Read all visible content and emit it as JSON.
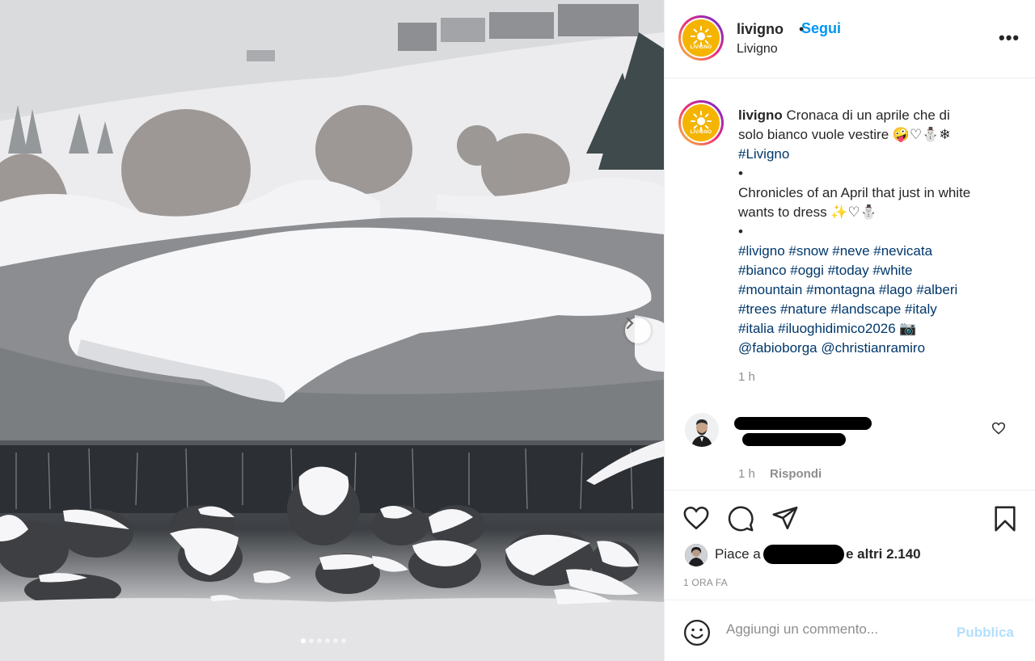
{
  "post": {
    "username": "livigno",
    "follow_separator": "•",
    "follow_label": "Segui",
    "location": "Livigno",
    "more_label": "•••",
    "avatar_brand": "LIVIGNO"
  },
  "caption": {
    "username": "livigno",
    "line1_text": "Cronaca di un aprile che di",
    "line2_text": "solo bianco vuole vestire 🤪♡⛄❄",
    "line3_text": "#Livigno",
    "bullet1": "•",
    "line5_text": "Chronicles of an April that just in white",
    "line6_text": "wants to dress ✨♡⛄",
    "bullet2": "•",
    "hashtags": [
      "#livigno #snow #neve #nevicata",
      "#bianco #oggi #today #white",
      "#mountain #montagna #lago #alberi",
      "#trees #nature #landscape #italy",
      "#italia #iluoghidimico2026 📷",
      "@fabioborga @christianramiro"
    ],
    "time": "1 h"
  },
  "comment": {
    "time": "1 h",
    "reply_label": "Rispondi"
  },
  "likes": {
    "prefix": "Piace a",
    "suffix": "e altri 2.140",
    "time_ago": "1 ORA FA"
  },
  "add_comment": {
    "placeholder": "Aggiungi un commento...",
    "publish_label": "Pubblica"
  },
  "carousel": {
    "slides": 6,
    "active_index": 0
  },
  "colors": {
    "link_blue": "#0095f6",
    "hashtag_blue": "#00376b",
    "publish_disabled": "#b2dffc",
    "muted_text": "#8e8e8e",
    "avatar_yellow": "#f5b400"
  }
}
